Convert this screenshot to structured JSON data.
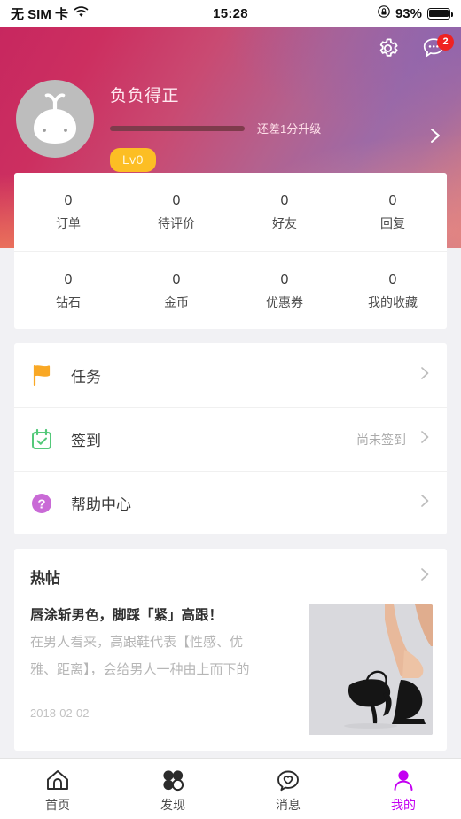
{
  "status_bar": {
    "carrier": "无 SIM 卡",
    "wifi_icon": "wifi-icon",
    "time": "15:28",
    "rotation_lock_icon": "rotation-lock-icon",
    "battery_percent": "93%",
    "battery_icon": "battery-icon"
  },
  "header": {
    "gear_icon": "gear-icon",
    "message_icon": "message-bubble-icon",
    "message_badge": "2",
    "avatar_icon": "default-avatar-icon",
    "username": "负负得正",
    "progress_percent": 0,
    "upgrade_hint": "还差1分升级",
    "level_badge": "Lv0",
    "chevron_icon": "chevron-right-icon",
    "accent_gold": "#fcbe24",
    "badge_red": "#ef2222"
  },
  "stats": {
    "rows": [
      [
        {
          "value": "0",
          "label": "订单"
        },
        {
          "value": "0",
          "label": "待评价"
        },
        {
          "value": "0",
          "label": "好友"
        },
        {
          "value": "0",
          "label": "回复"
        }
      ],
      [
        {
          "value": "0",
          "label": "钻石"
        },
        {
          "value": "0",
          "label": "金币"
        },
        {
          "value": "0",
          "label": "优惠券"
        },
        {
          "value": "0",
          "label": "我的收藏"
        }
      ]
    ]
  },
  "menu": {
    "items": [
      {
        "label": "任务",
        "value": "",
        "icon": "flag-icon",
        "icon_color": "#f9a825"
      },
      {
        "label": "签到",
        "value": "尚未签到",
        "icon": "calendar-check-icon",
        "icon_color": "#54c97a"
      },
      {
        "label": "帮助中心",
        "value": "",
        "icon": "question-circle-icon",
        "icon_color": "#c96ad6"
      }
    ]
  },
  "hot_post": {
    "section_title": "热帖",
    "chevron_icon": "chevron-right-icon",
    "post_title": "唇涂斩男色，脚踩「紧」高跟！",
    "excerpt_line1": "在男人看来，高跟鞋代表【性感、优",
    "excerpt_line2": "雅、距离】，会给男人一种由上而下的",
    "date": "2018-02-02",
    "thumbnail_icon": "high-heels-photo"
  },
  "tabbar": {
    "active_color": "#c400f2",
    "items": [
      {
        "label": "首页",
        "icon": "home-icon",
        "active": false
      },
      {
        "label": "发现",
        "icon": "clover-discover-icon",
        "active": false
      },
      {
        "label": "消息",
        "icon": "heart-chat-icon",
        "active": false
      },
      {
        "label": "我的",
        "icon": "person-icon",
        "active": true
      }
    ]
  }
}
